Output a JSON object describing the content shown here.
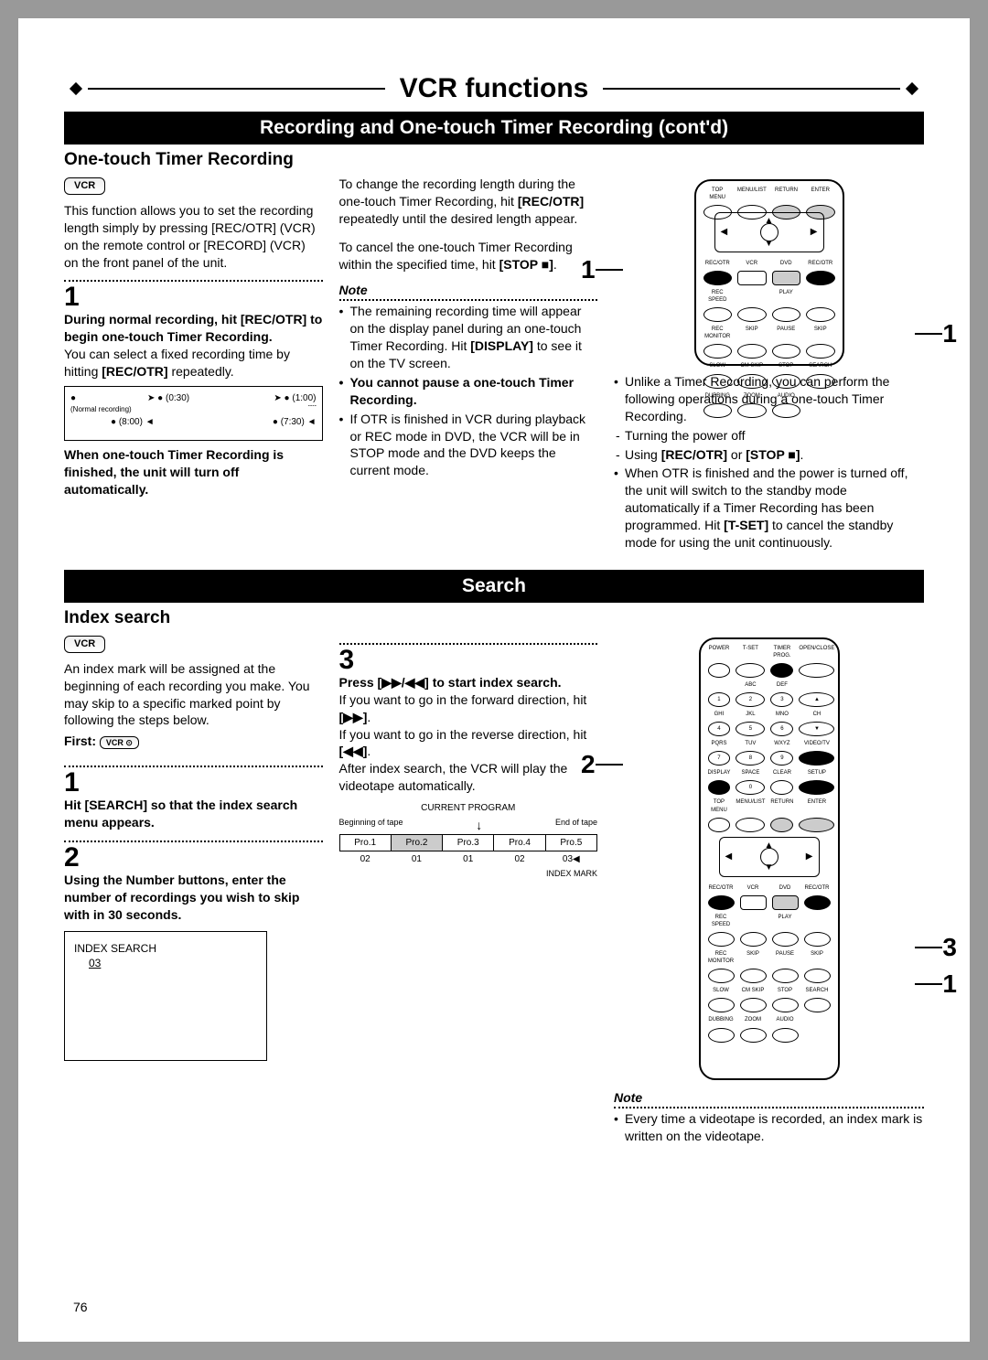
{
  "header": {
    "title": "VCR functions"
  },
  "band1": "Recording and One-touch Timer Recording (cont'd)",
  "otr": {
    "heading": "One-touch Timer Recording",
    "badge": "VCR",
    "intro": "This function allows you to set the recording length simply by pressing [REC/OTR] (VCR) on the remote control or [RECORD] (VCR) on the front panel of the unit.",
    "step1": {
      "num": "1",
      "bold": "During normal recording, hit [REC/OTR] to begin one-touch Timer Recording.",
      "text": "You can select a fixed recording time by hitting [REC/OTR] repeatedly."
    },
    "diagram": {
      "normal": "(Normal recording)",
      "t030": "(0:30)",
      "t100": "(1:00)",
      "t800": "(8:00)",
      "t730": "(7:30)"
    },
    "afterDiagram": "When one-touch Timer Recording is finished, the unit will turn off automatically.",
    "col2a": "To change the recording length during the one-touch Timer Recording, hit [REC/OTR] repeatedly until the desired length appear.",
    "col2b": "To cancel the one-touch Timer Recording within the specified time, hit [STOP ■].",
    "noteHdr": "Note",
    "noteItems": [
      "The remaining recording time will appear on the display panel during an one-touch Timer Recording. Hit [DISPLAY] to see it on the TV screen.",
      "You cannot pause a one-touch Timer Recording.",
      "If OTR is finished in VCR during playback or REC mode in DVD, the VCR will be in STOP mode and the DVD keeps the current mode."
    ],
    "sideItems": [
      "Unlike a Timer Recording, you can perform the following operations during a one-touch Timer Recording.",
      "When OTR is finished and the power is turned off, the unit will switch to the standby mode automatically if a Timer Recording has been programmed. Hit [T-SET] to cancel the standby mode for using the unit continuously."
    ],
    "sideDash": [
      "Turning the power off",
      "Using [REC/OTR] or [STOP ■]."
    ],
    "callouts": {
      "left": "1",
      "right": "1"
    }
  },
  "band2": "Search",
  "search": {
    "heading": "Index search",
    "badge": "VCR",
    "intro": "An index mark will be assigned at the beginning of each recording you make. You may skip to a specific marked point by following the steps below.",
    "first": "First:",
    "step1": {
      "num": "1",
      "text": "Hit [SEARCH] so that the index search menu appears."
    },
    "step2": {
      "num": "2",
      "text": "Using the Number buttons, enter the number of recordings you wish to skip with in 30 seconds."
    },
    "osd": {
      "title": "INDEX SEARCH",
      "val": "03"
    },
    "step3": {
      "num": "3",
      "bold": "Press [▶▶/◀◀] to start index search.",
      "l1": "If you want to go in the forward direction, hit [▶▶].",
      "l2": "If you want to go in the reverse direction, hit [◀◀].",
      "l3": "After index search, the VCR will play the videotape automatically."
    },
    "tape": {
      "title": "CURRENT PROGRAM",
      "beg": "Beginning of tape",
      "end": "End of tape",
      "cols": [
        "Pro.1",
        "Pro.2",
        "Pro.3",
        "Pro.4",
        "Pro.5"
      ],
      "vals": [
        "02",
        "01",
        "01",
        "02",
        "03◀"
      ],
      "mark": "INDEX MARK"
    },
    "note": {
      "hdr": "Note",
      "txt": "Every time a videotape is recorded, an index mark is written on the videotape."
    },
    "callouts": {
      "c2": "2",
      "c3": "3",
      "c1": "1"
    }
  },
  "remoteLabels": {
    "row1": [
      "TOP MENU",
      "MENU/LIST",
      "RETURN",
      "ENTER"
    ],
    "row2": [
      "REC/OTR",
      "VCR",
      "DVD",
      "REC/OTR"
    ],
    "row3": [
      "REC SPEED",
      "",
      "PLAY",
      ""
    ],
    "row4": [
      "REC MONITOR",
      "SKIP",
      "PAUSE",
      "SKIP"
    ],
    "row5": [
      "SLOW",
      "CM SKIP",
      "STOP",
      "SEARCH"
    ],
    "row6": [
      "DUBBING",
      "ZOOM",
      "AUDIO",
      ""
    ],
    "numPad": [
      "1",
      "2",
      "3",
      "4",
      "5",
      "6",
      "7",
      "8",
      "9",
      "0"
    ],
    "topSmall": [
      "POWER",
      "T-SET",
      "TIMER PROG.",
      "OPEN/CLOSE"
    ],
    "r1s": [
      "",
      "ABC",
      "DEF",
      ""
    ],
    "r2s": [
      "GHI",
      "JKL",
      "MNO",
      "CH"
    ],
    "r3s": [
      "PQRS",
      "TUV",
      "WXYZ",
      "VIDEO/TV"
    ],
    "r4s": [
      "DISPLAY",
      "SPACE",
      "CLEAR",
      "SETUP"
    ]
  },
  "page": "76"
}
